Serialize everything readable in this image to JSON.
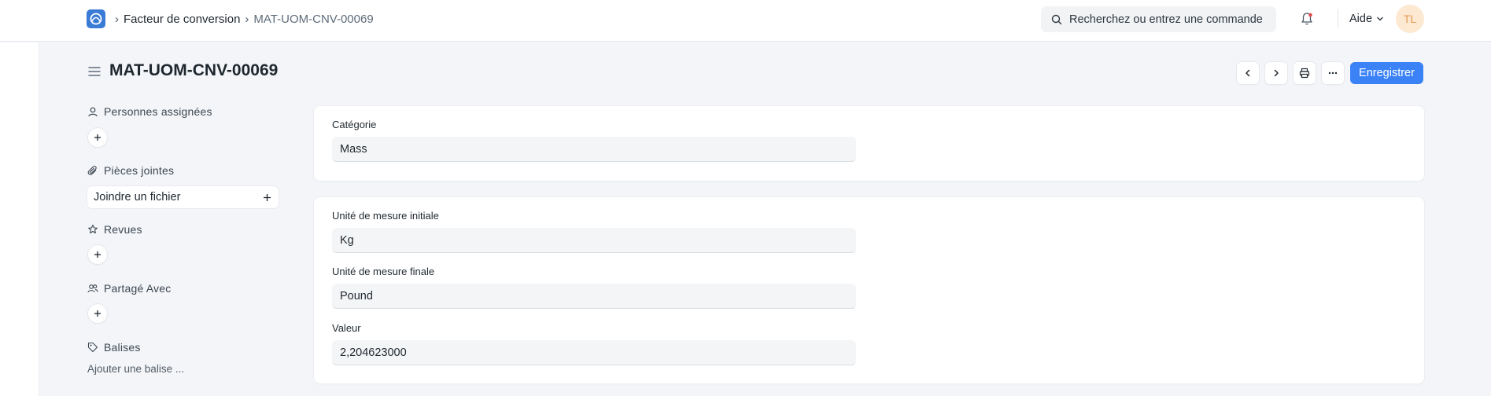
{
  "navbar": {
    "breadcrumbs": [
      "Facteur de conversion",
      "MAT-UOM-CNV-00069"
    ],
    "search_placeholder": "Recherchez ou entrez une commande",
    "help_label": "Aide",
    "avatar_initials": "TL"
  },
  "header": {
    "title": "MAT-UOM-CNV-00069",
    "save_label": "Enregistrer",
    "accent_color": "#3b82f6"
  },
  "sidebar": {
    "assigned_label": "Personnes assignées",
    "attachments_label": "Pièces jointes",
    "attach_file_label": "Joindre un fichier",
    "reviews_label": "Revues",
    "shared_label": "Partagé Avec",
    "tags_label": "Balises",
    "add_tag_label": "Ajouter une balise ..."
  },
  "form": {
    "category": {
      "label": "Catégorie",
      "value": "Mass"
    },
    "from_uom": {
      "label": "Unité de mesure initiale",
      "value": "Kg"
    },
    "to_uom": {
      "label": "Unité de mesure finale",
      "value": "Pound"
    },
    "value": {
      "label": "Valeur",
      "value": "2,204623000"
    }
  }
}
